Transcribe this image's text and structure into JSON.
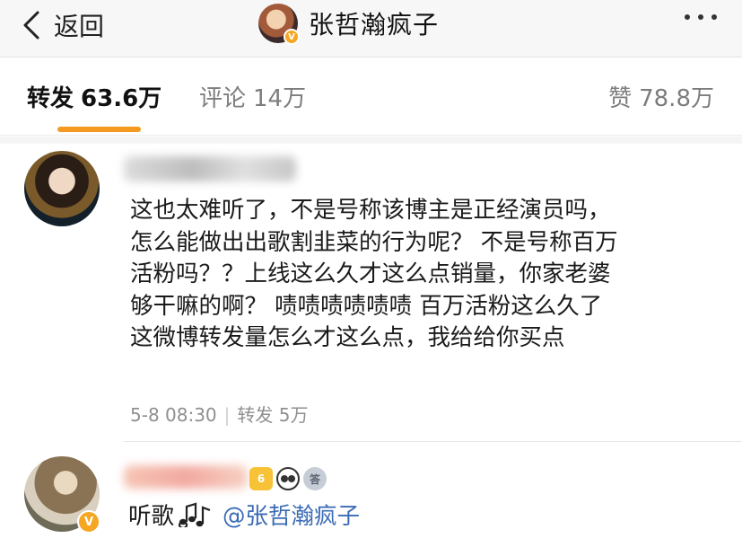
{
  "nav": {
    "back_label": "返回",
    "title": "张哲瀚疯子",
    "verified_badge": "V"
  },
  "tabs": {
    "repost": {
      "label": "转发",
      "count": "63.6万"
    },
    "comment": {
      "label": "评论",
      "count": "14万"
    },
    "like": {
      "label": "赞",
      "count": "78.8万"
    }
  },
  "comments": [
    {
      "text_lines": [
        "这也太难听了，不是号称该博主是正经演员吗，",
        "怎么能做出出歌割韭菜的行为呢？  不是号称百万",
        "活粉吗？？上线这么久才这么点销量，你家老婆",
        "够干嘛的啊？ 啧啧啧啧啧啧  百万活粉这么久了",
        "这微博转发量怎么才这么点，我给给你买点"
      ],
      "time": "5-8 08:30",
      "separator": "|",
      "reposts": "转发 5万"
    },
    {
      "reply_text": "听歌",
      "mention": "@张哲瀚疯子",
      "verified_badge": "V",
      "crown_level": "6",
      "medal_label": "答"
    }
  ],
  "colors": {
    "accent": "#f59a20",
    "mention": "#3b6bb5",
    "muted": "#8f8f8f"
  }
}
